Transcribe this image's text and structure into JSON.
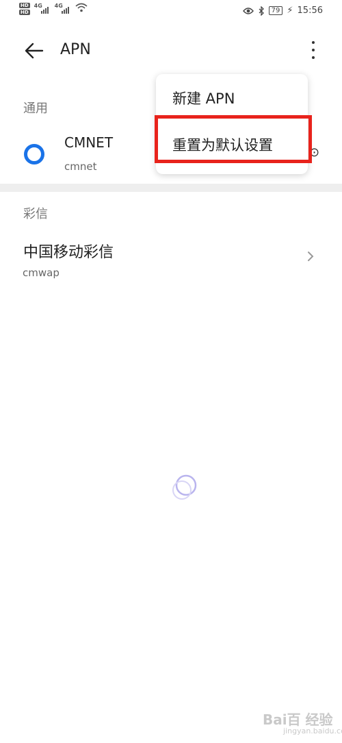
{
  "status_bar": {
    "hd1": "HD",
    "hd2": "HD",
    "signal1": "4G",
    "signal2": "4G",
    "battery": "79",
    "time": "15:56"
  },
  "app_bar": {
    "title": "APN"
  },
  "sections": {
    "general_label": "通用",
    "mms_label": "彩信"
  },
  "apns": {
    "general": {
      "name": "CMNET",
      "apn": "cmnet"
    },
    "mms": {
      "name": "中国移动彩信",
      "apn": "cmwap"
    }
  },
  "menu": {
    "new_apn": "新建 APN",
    "reset_default": "重置为默认设置"
  },
  "watermark": {
    "main": "Bai百 经验",
    "sub": "jingyan.baidu.com"
  },
  "colors": {
    "accent": "#1a73e8",
    "highlight": "#e8231c"
  }
}
